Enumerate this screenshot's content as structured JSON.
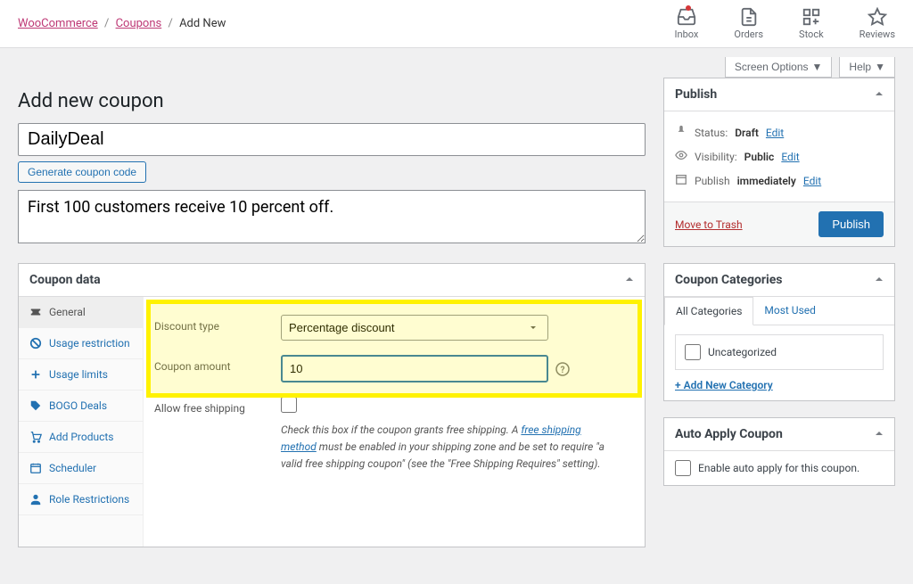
{
  "breadcrumbs": {
    "root": "WooCommerce",
    "parent": "Coupons",
    "current": "Add New"
  },
  "top_icons": {
    "inbox": "Inbox",
    "orders": "Orders",
    "stock": "Stock",
    "reviews": "Reviews"
  },
  "screen_options": {
    "screen_options_label": "Screen Options",
    "help_label": "Help"
  },
  "page": {
    "title": "Add new coupon",
    "coupon_title_value": "DailyDeal",
    "generate_code_label": "Generate coupon code",
    "description_value": "First 100 customers receive 10 percent off."
  },
  "coupon_data": {
    "panel_title": "Coupon data",
    "tabs": {
      "general": "General",
      "usage_restriction": "Usage restriction",
      "usage_limits": "Usage limits",
      "bogo_deals": "BOGO Deals",
      "add_products": "Add Products",
      "scheduler": "Scheduler",
      "role_restrictions": "Role Restrictions"
    },
    "fields": {
      "discount_type_label": "Discount type",
      "discount_type_value": "Percentage discount",
      "coupon_amount_label": "Coupon amount",
      "coupon_amount_value": "10",
      "allow_free_shipping_label": "Allow free shipping",
      "free_shipping_desc_pre": "Check this box if the coupon grants free shipping. A ",
      "free_shipping_link1": "free shipping method",
      "free_shipping_desc_mid": " must be enabled in your shipping zone and be set to require \"a valid free shipping coupon\" (see the \"Free Shipping Requires\" setting)."
    }
  },
  "publish": {
    "title": "Publish",
    "status_label": "Status:",
    "status_value": "Draft",
    "visibility_label": "Visibility:",
    "visibility_value": "Public",
    "publish_label": "Publish",
    "publish_value": "immediately",
    "edit_label": "Edit",
    "trash_label": "Move to Trash",
    "publish_btn_label": "Publish"
  },
  "categories": {
    "title": "Coupon Categories",
    "tab_all": "All Categories",
    "tab_most_used": "Most Used",
    "uncategorized": "Uncategorized",
    "add_new_label": "+ Add New Category"
  },
  "auto_apply": {
    "title": "Auto Apply Coupon",
    "enable_label": "Enable auto apply for this coupon."
  }
}
